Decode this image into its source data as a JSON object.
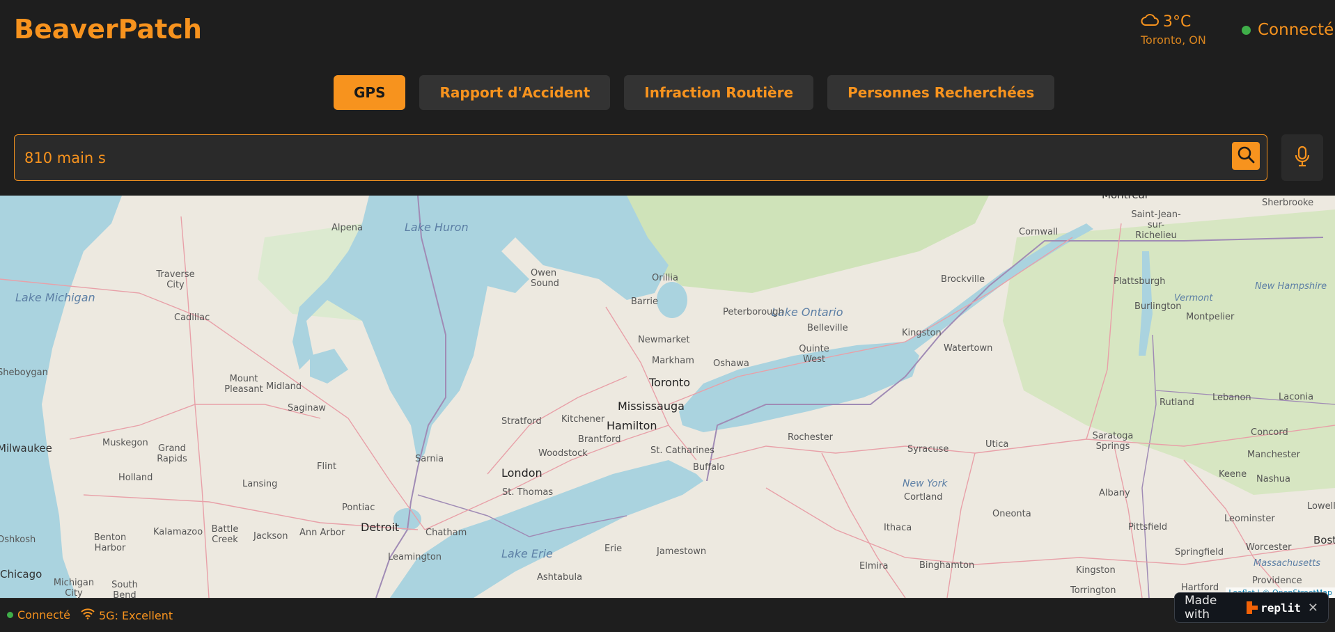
{
  "brand": "BeaverPatch",
  "weather": {
    "temp": "3°C",
    "location": "Toronto, ON",
    "icon": "cloud-icon"
  },
  "connection": {
    "label": "Connecté",
    "color": "#3fae49"
  },
  "tabs": [
    {
      "label": "GPS",
      "active": true
    },
    {
      "label": "Rapport d'Accident",
      "active": false
    },
    {
      "label": "Infraction Routière",
      "active": false
    },
    {
      "label": "Personnes Recherchées",
      "active": false
    }
  ],
  "search": {
    "value": "810 main s",
    "icon": "search-icon",
    "mic_icon": "microphone-icon"
  },
  "map": {
    "water_labels": [
      "Lake Huron",
      "Lake Michigan",
      "Lake Ontario",
      "Lake Erie"
    ],
    "region_labels": [
      "New York",
      "Vermont",
      "New Hampshire",
      "Massachusetts"
    ],
    "cities": [
      "Montreal",
      "Sherbrooke",
      "Saint-Jean-sur-Richelieu",
      "Cornwall",
      "Alpena",
      "Owen Sound",
      "Orillia",
      "Traverse City",
      "Barrie",
      "Brockville",
      "Plattsburgh",
      "Peterborough",
      "Burlington",
      "Cadillac",
      "Belleville",
      "Kingston",
      "Montpelier",
      "Newmarket",
      "Watertown",
      "Quinte West",
      "Markham",
      "Oshawa",
      "Mount Pleasant",
      "Midland",
      "Toronto",
      "Lebanon",
      "Laconia",
      "Saginaw",
      "Mississauga",
      "Rutland",
      "Stratford",
      "Kitchener",
      "Hamilton",
      "Rochester",
      "Muskegon",
      "Brantford",
      "St. Catharines",
      "Syracuse",
      "Utica",
      "Saratoga Springs",
      "Concord",
      "Grand Rapids",
      "Woodstock",
      "Buffalo",
      "Manchester",
      "Flint",
      "Sarnia",
      "London",
      "Keene",
      "Holland",
      "Lansing",
      "Cortland",
      "Albany",
      "Nashua",
      "St. Thomas",
      "Pontiac",
      "Lowell",
      "Oneonta",
      "Leominster",
      "Kalamazoo",
      "Detroit",
      "Ithaca",
      "Pittsfield",
      "Battle Creek",
      "Jackson",
      "Ann Arbor",
      "Chatham",
      "Benton Harbor",
      "Erie",
      "Jamestown",
      "Springfield",
      "Worcester",
      "Leamington",
      "Elmira",
      "Binghamton",
      "Kingston",
      "Chicago",
      "Michigan City",
      "South Bend",
      "Ashtabula",
      "Torrington",
      "Hartford",
      "Providence",
      "Bosto",
      "Milwaukee",
      "Oshkosh",
      "Sheboygan"
    ],
    "attribution": "Leaflet | © OpenStreetMap"
  },
  "statusbar": {
    "connection": "Connecté",
    "network": "5G: Excellent"
  },
  "replit_badge": {
    "prefix": "Made with",
    "name": "replit",
    "close": "✕"
  }
}
